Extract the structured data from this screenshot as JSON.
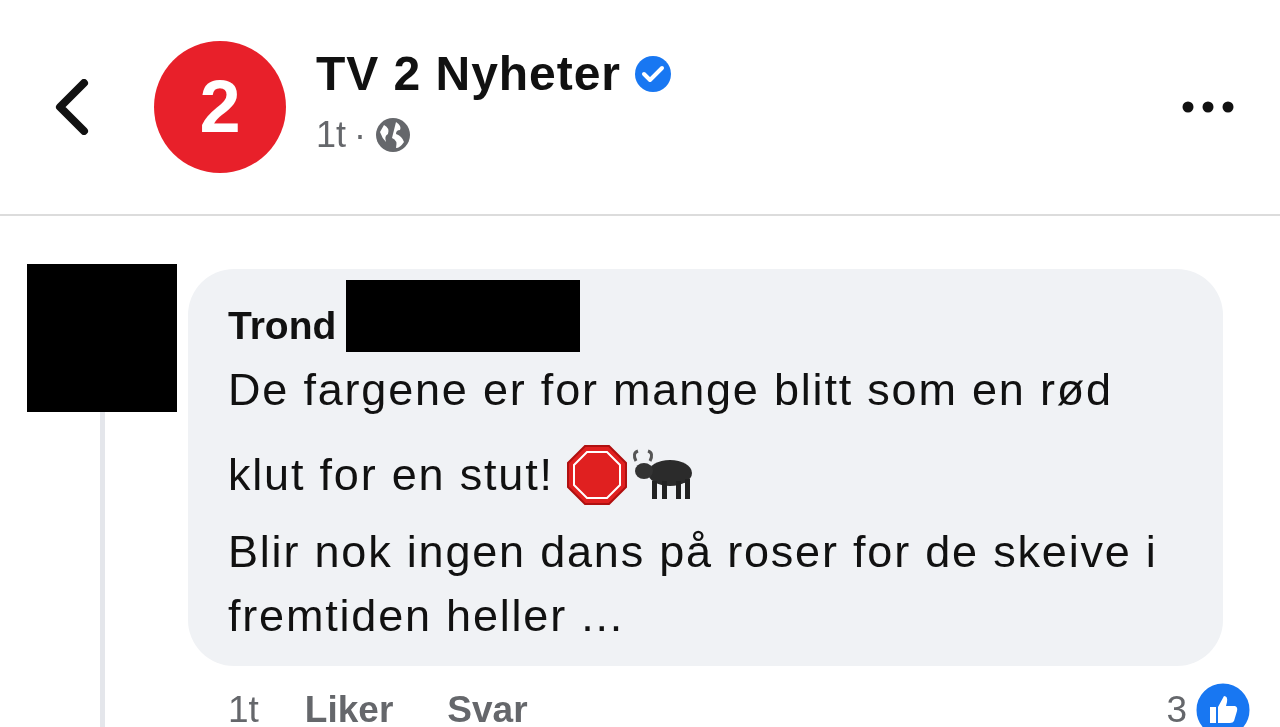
{
  "header": {
    "logo_text": "2",
    "page_name": "TV 2 Nyheter",
    "verified": true,
    "time": "1t",
    "separator": "·"
  },
  "comment": {
    "author": "Trond",
    "lines": [
      {
        "text": "De fargene er for mange blitt som en rød",
        "kind": "plain"
      },
      {
        "text": "klut for en stut!",
        "kind": "with-emoji"
      },
      {
        "text": "Blir nok ingen dans på roser for de skeive i fremtiden heller ...",
        "kind": "plain"
      }
    ],
    "time": "1t",
    "actions": [
      "Liker",
      "Svar"
    ],
    "reaction_count": "3"
  }
}
